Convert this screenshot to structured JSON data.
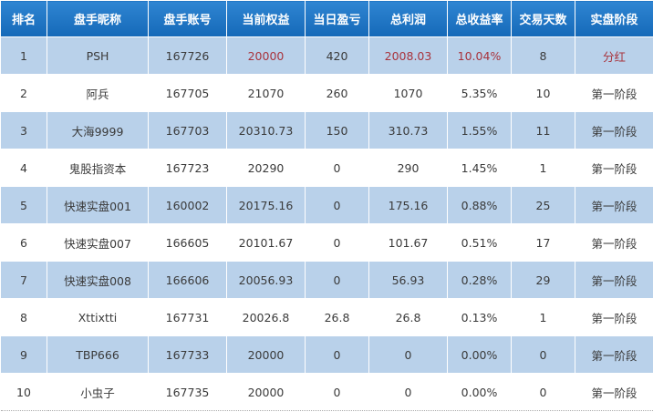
{
  "table": {
    "headers": [
      "排名",
      "盘手昵称",
      "盘手账号",
      "当前权益",
      "当日盈亏",
      "总利润",
      "总收益率",
      "交易天数",
      "实盘阶段"
    ],
    "highlight_color": "#a8333c",
    "rows": [
      [
        "1",
        "PSH",
        "167726",
        "20000",
        "420",
        "2008.03",
        "10.04%",
        "8",
        "分红"
      ],
      [
        "2",
        "阿兵",
        "167705",
        "21070",
        "260",
        "1070",
        "5.35%",
        "10",
        "第一阶段"
      ],
      [
        "3",
        "大海9999",
        "167703",
        "20310.73",
        "150",
        "310.73",
        "1.55%",
        "11",
        "第一阶段"
      ],
      [
        "4",
        "鬼股指资本",
        "167723",
        "20290",
        "0",
        "290",
        "1.45%",
        "1",
        "第一阶段"
      ],
      [
        "5",
        "快速实盘001",
        "160002",
        "20175.16",
        "0",
        "175.16",
        "0.88%",
        "25",
        "第一阶段"
      ],
      [
        "6",
        "快速实盘007",
        "166605",
        "20101.67",
        "0",
        "101.67",
        "0.51%",
        "17",
        "第一阶段"
      ],
      [
        "7",
        "快速实盘008",
        "166606",
        "20056.93",
        "0",
        "56.93",
        "0.28%",
        "29",
        "第一阶段"
      ],
      [
        "8",
        "Xttixtti",
        "167731",
        "20026.8",
        "26.8",
        "26.8",
        "0.13%",
        "1",
        "第一阶段"
      ],
      [
        "9",
        "TBP666",
        "167733",
        "20000",
        "0",
        "0",
        "0.00%",
        "0",
        "第一阶段"
      ],
      [
        "10",
        "小虫子",
        "167735",
        "20000",
        "0",
        "0",
        "0.00%",
        "0",
        "第一阶段"
      ]
    ]
  }
}
